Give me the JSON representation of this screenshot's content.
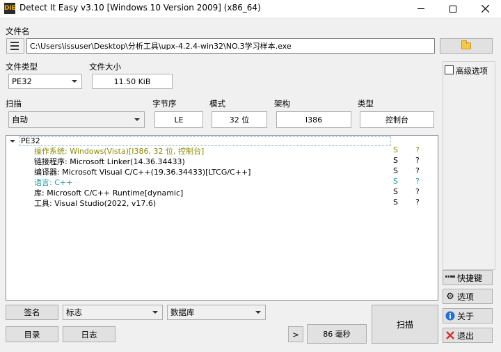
{
  "window": {
    "title": "Detect It Easy v3.10 [Windows 10 Version 2009] (x86_64)",
    "logo": "DiE"
  },
  "file": {
    "label": "文件名",
    "path": "C:\\Users\\issuser\\Desktop\\分析工具\\upx-4.2.4-win32\\NO.3学习样本.exe"
  },
  "filetype": {
    "label": "文件类型",
    "value": "PE32"
  },
  "filesize": {
    "label": "文件大小",
    "value": "11.50 KiB"
  },
  "scan": {
    "label": "扫描",
    "value": "自动"
  },
  "endian": {
    "label": "字节序",
    "value": "LE"
  },
  "mode": {
    "label": "模式",
    "value": "32 位"
  },
  "arch": {
    "label": "架构",
    "value": "I386"
  },
  "type": {
    "label": "类型",
    "value": "控制台"
  },
  "advanced": {
    "label": "高级选项"
  },
  "results": {
    "root": "PE32",
    "rows": [
      {
        "text": "操作系统: Windows(Vista)[I386, 32 位, 控制台]",
        "s": "S",
        "q": "?",
        "color": "#8a8a00"
      },
      {
        "text": "链接程序: Microsoft Linker(14.36.34433)",
        "s": "S",
        "q": "?",
        "color": "#000000"
      },
      {
        "text": "编译器: Microsoft Visual C/C++(19.36.34433)[LTCG/C++]",
        "s": "S",
        "q": "?",
        "color": "#000000"
      },
      {
        "text": "语言: C++",
        "s": "S",
        "q": "?",
        "color": "#1a9aa0"
      },
      {
        "text": "库: Microsoft C/C++ Runtime[dynamic]",
        "s": "S",
        "q": "?",
        "color": "#000000"
      },
      {
        "text": "工具: Visual Studio(2022, v17.6)",
        "s": "S",
        "q": "?",
        "color": "#000000"
      }
    ]
  },
  "bottom": {
    "signature": "签名",
    "flags": "标志",
    "database": "数据库",
    "directory": "目录",
    "log": "日志",
    "arrow": ">",
    "time": "86 毫秒",
    "scan": "扫描"
  },
  "side": {
    "shortcuts": "快捷键",
    "options": "选项",
    "about": "关于",
    "exit": "退出"
  },
  "colors": {
    "accent_yellow": "#f2b400",
    "info_blue": "#1e6fd9",
    "exit_red": "#d9302c"
  }
}
